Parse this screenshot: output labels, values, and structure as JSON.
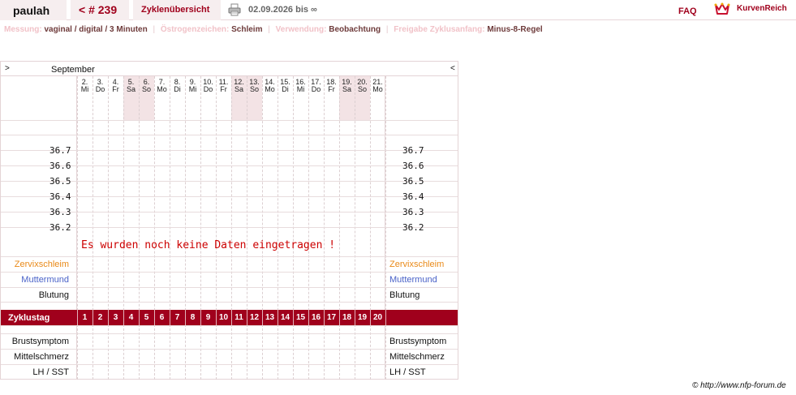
{
  "header": {
    "user": "paulah",
    "cycle": "< # 239",
    "overview": "Zyklenübersicht",
    "date_range": "02.09.2026 bis ∞",
    "faq": "FAQ",
    "brand": "KurvenReich"
  },
  "info": {
    "measurement_label": "Messung:",
    "measurement_value": "vaginal / digital / 3 Minuten",
    "estrogen_label": "Östrogenzeichen:",
    "estrogen_value": "Schleim",
    "usage_label": "Verwendung:",
    "usage_value": "Beobachtung",
    "release_label": "Freigabe Zyklusanfang:",
    "release_value": "Minus-8-Regel",
    "separator": "|"
  },
  "chart": {
    "nav_left": ">",
    "nav_right": "<",
    "month": "September",
    "days": [
      {
        "num": "2.",
        "name": "Mi",
        "weekend": false
      },
      {
        "num": "3.",
        "name": "Do",
        "weekend": false
      },
      {
        "num": "4.",
        "name": "Fr",
        "weekend": false
      },
      {
        "num": "5.",
        "name": "Sa",
        "weekend": true
      },
      {
        "num": "6.",
        "name": "So",
        "weekend": true
      },
      {
        "num": "7.",
        "name": "Mo",
        "weekend": false
      },
      {
        "num": "8.",
        "name": "Di",
        "weekend": false
      },
      {
        "num": "9.",
        "name": "Mi",
        "weekend": false
      },
      {
        "num": "10.",
        "name": "Do",
        "weekend": false
      },
      {
        "num": "11.",
        "name": "Fr",
        "weekend": false
      },
      {
        "num": "12.",
        "name": "Sa",
        "weekend": true
      },
      {
        "num": "13.",
        "name": "So",
        "weekend": true
      },
      {
        "num": "14.",
        "name": "Mo",
        "weekend": false
      },
      {
        "num": "15.",
        "name": "Di",
        "weekend": false
      },
      {
        "num": "16.",
        "name": "Mi",
        "weekend": false
      },
      {
        "num": "17.",
        "name": "Do",
        "weekend": false
      },
      {
        "num": "18.",
        "name": "Fr",
        "weekend": false
      },
      {
        "num": "19.",
        "name": "Sa",
        "weekend": true
      },
      {
        "num": "20.",
        "name": "So",
        "weekend": true
      },
      {
        "num": "21.",
        "name": "Mo",
        "weekend": false
      }
    ],
    "temperatures": [
      "36.7",
      "36.6",
      "36.5",
      "36.4",
      "36.3",
      "36.2"
    ],
    "no_data": "Es wurden noch keine Daten eingetragen !",
    "rows_top": [
      {
        "label": "Zervixschleim",
        "color": "#e98a19"
      },
      {
        "label": "Muttermund",
        "color": "#4a62c8"
      },
      {
        "label": "Blutung",
        "color": "#111111"
      }
    ],
    "cycle_label": "Zyklustag",
    "cycle_days": [
      "1",
      "2",
      "3",
      "4",
      "5",
      "6",
      "7",
      "8",
      "9",
      "10",
      "11",
      "12",
      "13",
      "14",
      "15",
      "16",
      "17",
      "18",
      "19",
      "20"
    ],
    "rows_bottom": [
      {
        "label": "Brustsymptom",
        "color": "#111111"
      },
      {
        "label": "Mittelschmerz",
        "color": "#111111"
      },
      {
        "label": "LH / SST",
        "color": "#111111"
      }
    ],
    "colors": {
      "accent": "#a0001c",
      "weekend": "#f3e3e5"
    }
  },
  "copyright": "© http://www.nfp-forum.de"
}
